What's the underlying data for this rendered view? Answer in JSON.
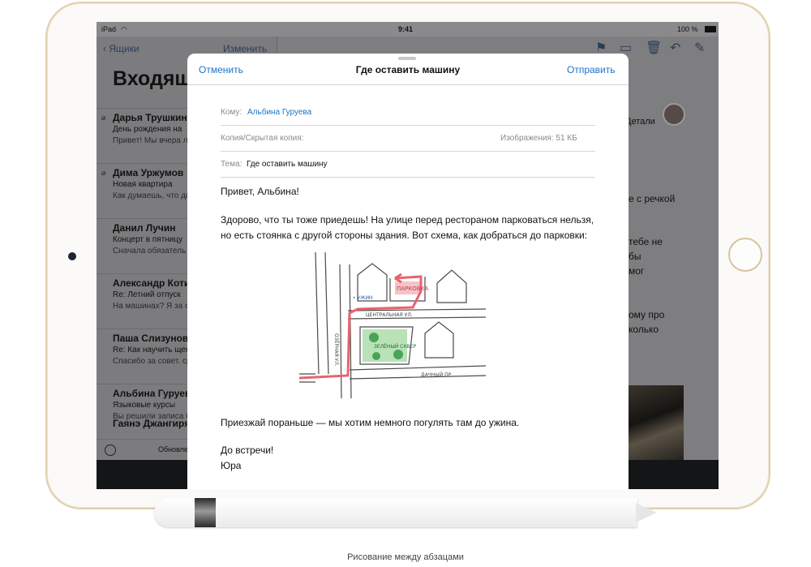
{
  "status_bar": {
    "device": "iPad",
    "time": "9:41",
    "battery": "100 %"
  },
  "mail_list": {
    "back_label": "Ящики",
    "edit_label": "Изменить",
    "title": "Входящие",
    "messages": [
      {
        "sender": "Дарья Трушкина",
        "subject": "День рождения на",
        "preview": "Привет! Мы вчера лодках! Было так в",
        "attachment": true
      },
      {
        "sender": "Дима Уржумов",
        "subject": "Новая квартира",
        "preview": "Как думаешь, что дизайнера, с кото",
        "attachment": true
      },
      {
        "sender": "Данил Лучин",
        "subject": "Концерт в пятницу",
        "preview": "Сначала обязатель последний альбом",
        "attachment": false
      },
      {
        "sender": "Александр Котин",
        "subject": "Re: Летний отпуск",
        "preview": "На машинах? Я за с удовольствием по",
        "attachment": false
      },
      {
        "sender": "Паша Слизунов",
        "subject": "Re: Как научить щен",
        "preview": "Спасибо за совет. сработал!",
        "attachment": false
      },
      {
        "sender": "Альбина Гуруева",
        "subject": "Языковые курсы",
        "preview": "Вы решили записа бы вместе? Вот прямо с",
        "attachment": false
      },
      {
        "sender": "Гаянэ Джангирян",
        "subject": "",
        "preview": "",
        "attachment": false
      }
    ],
    "footer_status": "Обновлено"
  },
  "detail_pane": {
    "details_link": "Детали",
    "fragments": [
      "е с речкой",
      "тебе не",
      "бы",
      "мог",
      "ому про",
      "колько"
    ]
  },
  "compose": {
    "cancel_label": "Отменить",
    "title": "Где оставить машину",
    "send_label": "Отправить",
    "to_label": "Кому:",
    "to_value": "Альбина Гуруева",
    "cc_label": "Копия/Скрытая копия:",
    "images_label": "Изображения: 51 КБ",
    "subject_label": "Тема:",
    "subject_value": "Где оставить машину",
    "greeting": "Привет, Альбина!",
    "paragraph_line1": "Здорово, что ты тоже приедешь! На улице перед рестораном парковаться нельзя,",
    "paragraph_line2": "но есть стоянка с другой стороны здания. Вот схема, как добраться до парковки:",
    "map": {
      "parking": "ПАРКОВКА",
      "dinner": "• УЖИН",
      "central_st": "ЦЕНТРАЛЬНАЯ УЛ.",
      "lake_st": "ОЗЁРНАЯ УЛ.",
      "park": "ЗЕЛЁНЫЙ СКВЕР",
      "dacha_ave": "ДАЧНЫЙ ПР."
    },
    "closing_line": "Приезжай пораньше — мы хотим немного погулять там до ужина.",
    "signoff": "До встречи!",
    "signature": "Юра"
  },
  "caption": "Рисование между абзацами",
  "colors": {
    "accent": "#1a73c9",
    "frame": "#e2cfae",
    "route": "#e8636d"
  },
  "icons": [
    "chevron-left-icon",
    "flag-icon",
    "folder-icon",
    "trash-icon",
    "reply-icon",
    "compose-icon",
    "paperclip-icon",
    "filter-icon",
    "wifi-icon",
    "battery-icon"
  ]
}
